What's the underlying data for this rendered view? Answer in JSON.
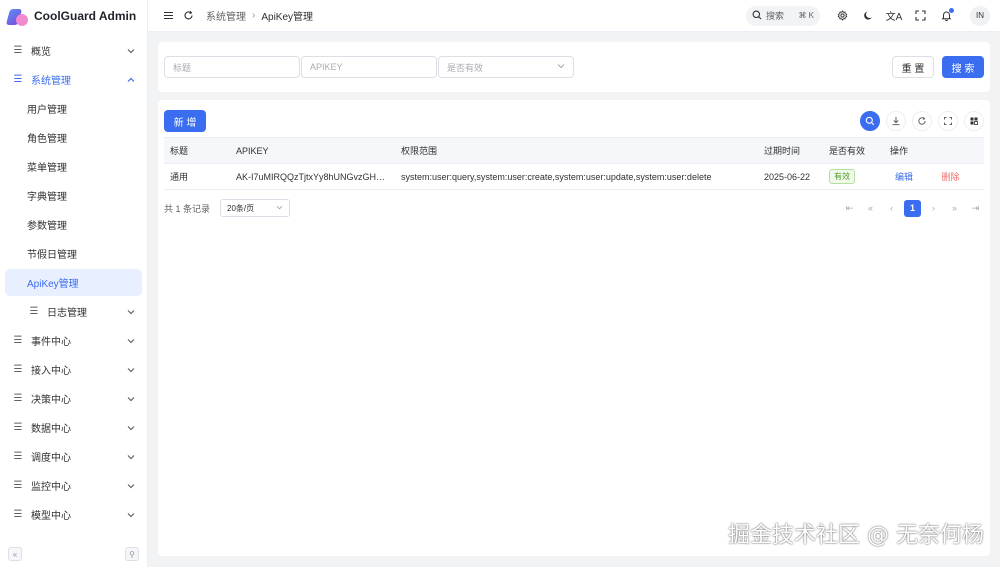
{
  "app": {
    "title": "CoolGuard Admin"
  },
  "sidebar": {
    "items": [
      {
        "label": "概览"
      },
      {
        "label": "系统管理"
      },
      {
        "label": "用户管理"
      },
      {
        "label": "角色管理"
      },
      {
        "label": "菜单管理"
      },
      {
        "label": "字典管理"
      },
      {
        "label": "参数管理"
      },
      {
        "label": "节假日管理"
      },
      {
        "label": "ApiKey管理"
      },
      {
        "label": "日志管理"
      },
      {
        "label": "事件中心"
      },
      {
        "label": "接入中心"
      },
      {
        "label": "决策中心"
      },
      {
        "label": "数据中心"
      },
      {
        "label": "调度中心"
      },
      {
        "label": "监控中心"
      },
      {
        "label": "模型中心"
      }
    ],
    "collapse_glyph": "«",
    "pin_glyph": "⚲"
  },
  "header": {
    "breadcrumb": [
      "系统管理",
      "ApiKey管理"
    ],
    "search_label": "搜索",
    "search_shortcut": "⌘ K",
    "avatar_text": "IN"
  },
  "filter": {
    "title_placeholder": "标题",
    "apikey_placeholder": "APIKEY",
    "valid_placeholder": "是否有效",
    "reset_label": "重 置",
    "search_label": "搜 索"
  },
  "table": {
    "add_label": "新 增",
    "columns": [
      "标题",
      "APIKEY",
      "权限范围",
      "过期时间",
      "是否有效",
      "操作"
    ],
    "rows": [
      {
        "title": "通用",
        "apikey": "AK-I7uMIRQQzTjtxYy8hUNGvzGHH...",
        "scope": "system:user:query,system:user:create,system:user:update,system:user:delete",
        "expire": "2025-06-22",
        "valid": "有效",
        "edit": "编辑",
        "delete": "删除"
      }
    ]
  },
  "pagination": {
    "total_text": "共 1 条记录",
    "page_size": "20条/页",
    "current_page": "1"
  },
  "watermark": "掘金技术社区 @ 无奈何杨",
  "colors": {
    "primary": "#3a6df0",
    "danger": "#f56c6c",
    "success": "#529b2e"
  }
}
